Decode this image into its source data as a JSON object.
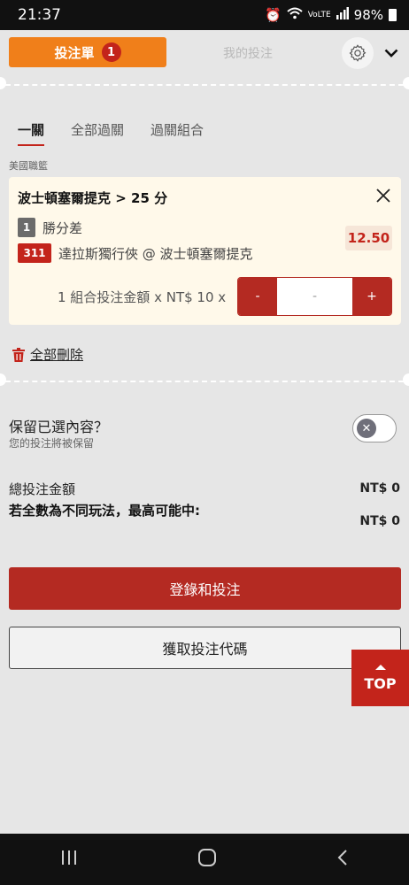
{
  "status_bar": {
    "time": "21:37",
    "battery": "98%"
  },
  "header": {
    "betslip_tab": "投注單",
    "betslip_count": "1",
    "mybets_tab": "我的投注"
  },
  "bet_tabs": [
    "一關",
    "全部過關",
    "過關組合"
  ],
  "league": "美國職籃",
  "bet": {
    "title": "波士頓塞爾提克 > 25 分",
    "market_number": "1",
    "market_name": "勝分差",
    "selection_number": "311",
    "selection_name": "達拉斯獨行俠 @ 波士頓塞爾提克",
    "odds": "12.50",
    "stake_label": "1 組合投注金額 x NT$ 10 x",
    "stake_minus": "-",
    "stake_value": "-",
    "stake_plus": "+"
  },
  "delete_all": "全部刪除",
  "keep": {
    "title": "保留已選內容？",
    "subtitle": "您的投注將被保留",
    "enabled": false
  },
  "summary": {
    "total_label": "總投注金額",
    "total_value": "NT$ 0",
    "maxwin_label": "若全數為不同玩法，最高可能中:",
    "maxwin_value": "NT$ 0"
  },
  "buttons": {
    "login_bet": "登錄和投注",
    "get_code": "獲取投注代碼",
    "top": "TOP"
  },
  "colors": {
    "accent_orange": "#f07f1a",
    "accent_red": "#b42a22",
    "background": "#e6e6e6",
    "card": "#fff9ea"
  }
}
